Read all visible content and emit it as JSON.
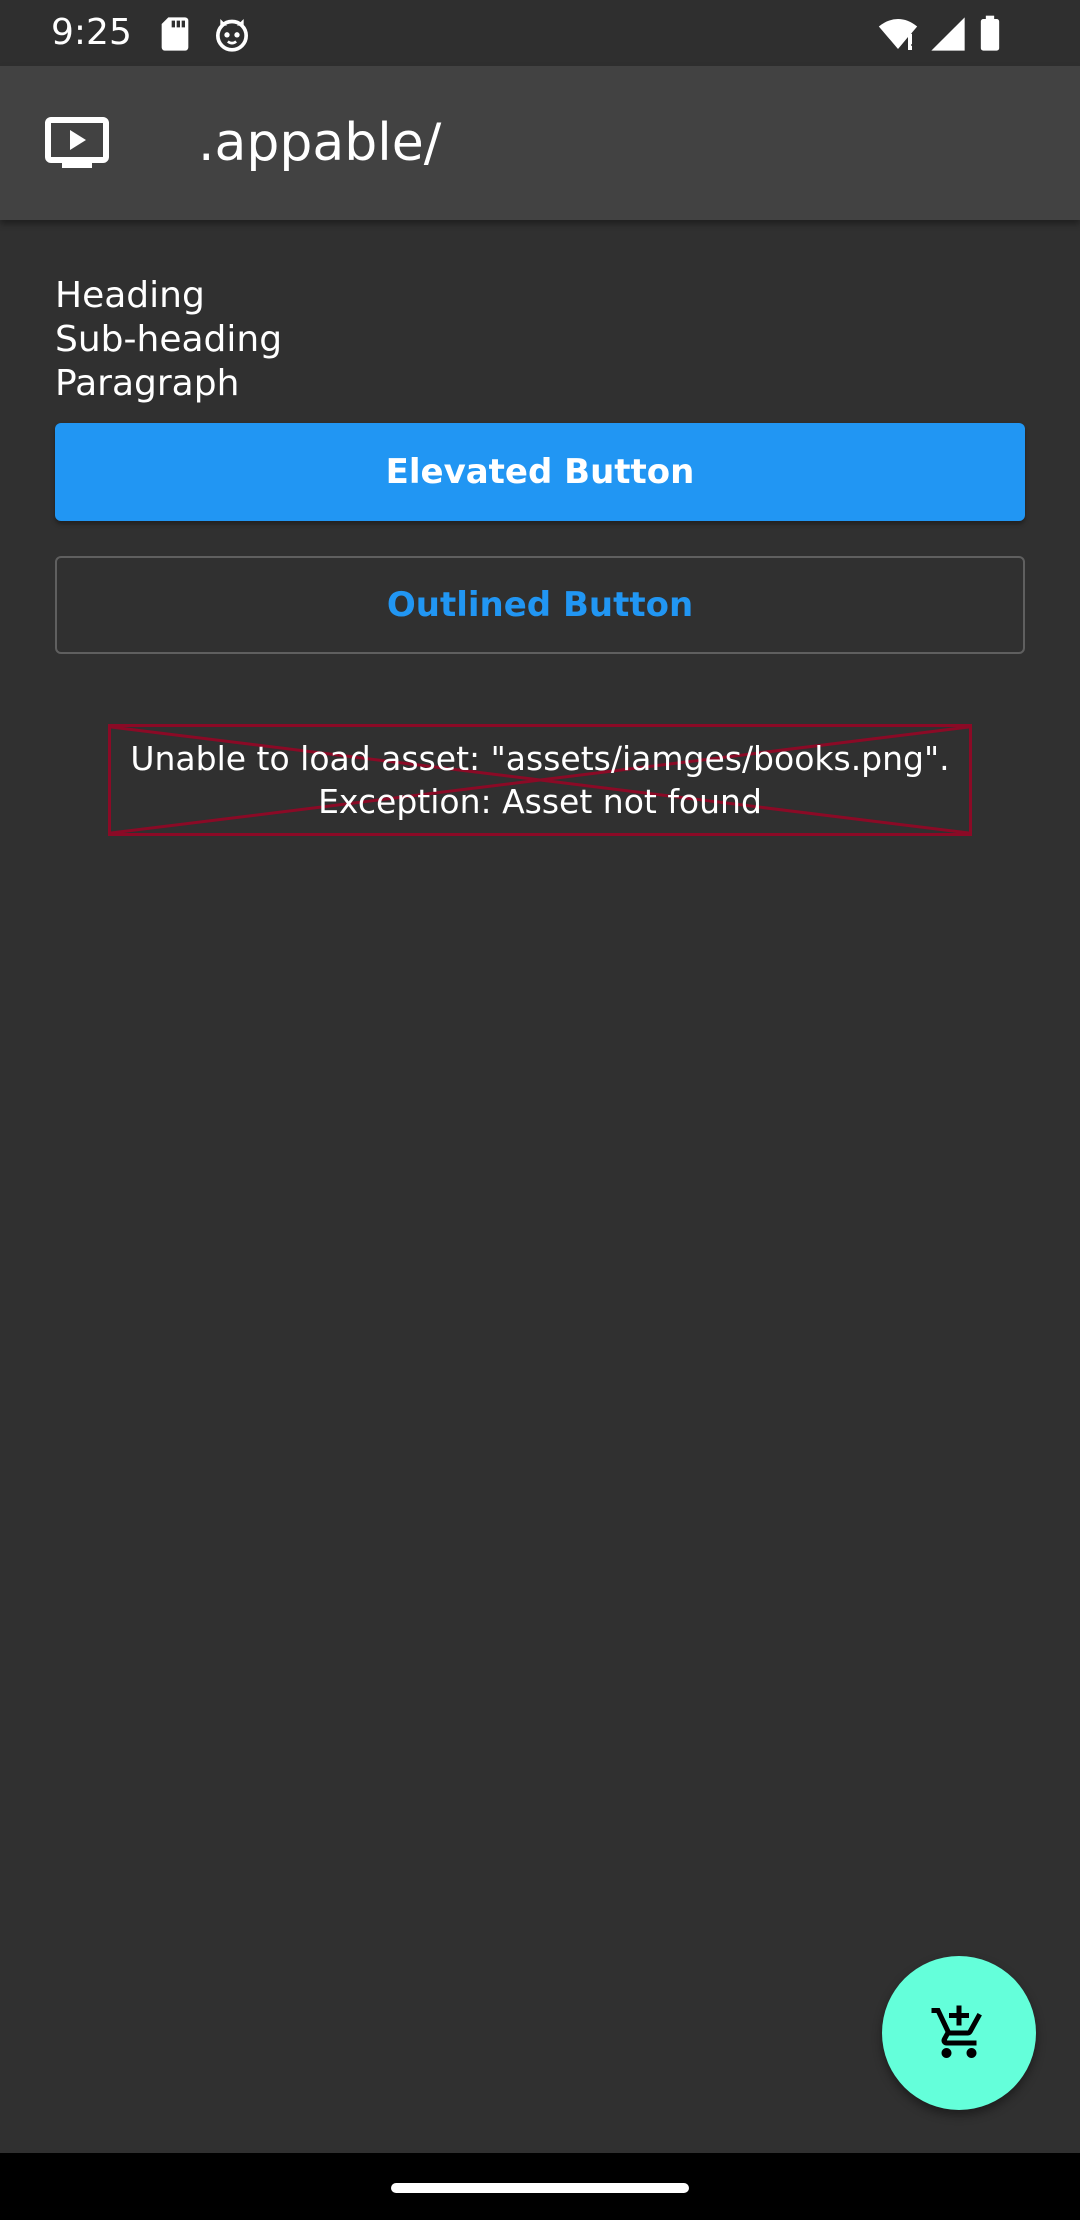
{
  "status_bar": {
    "time": "9:25",
    "icons": [
      "sd-card-icon",
      "cat-face-icon",
      "wifi-alert-icon",
      "signal-icon",
      "battery-icon"
    ]
  },
  "app_bar": {
    "icon": "tv-play-icon",
    "title": ".appable/"
  },
  "content": {
    "heading": "Heading",
    "subheading": "Sub-heading",
    "paragraph": "Paragraph",
    "elevated_button_label": "Elevated Button",
    "outlined_button_label": "Outlined Button",
    "error_message": "Unable to load asset: \"assets/iamges/books.png\".\nException: Asset not found"
  },
  "fab": {
    "icon": "add-shopping-cart-icon"
  },
  "colors": {
    "background": "#303030",
    "app_bar": "#424242",
    "primary": "#2196f3",
    "fab": "#64ffda",
    "error_border": "#8b0a26"
  }
}
